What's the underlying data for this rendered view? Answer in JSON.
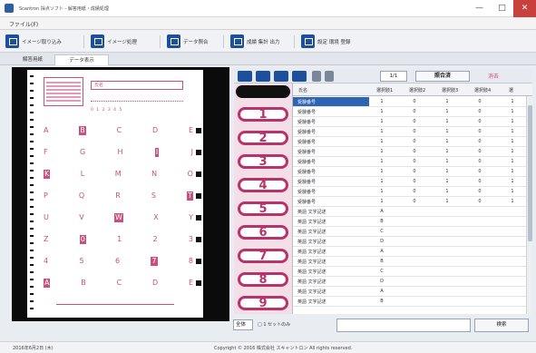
{
  "window": {
    "title": "Scantron 採点ソフト - 解答用紙・成績処理",
    "controls": {
      "minimize": "—",
      "maximize": "□",
      "close": "✕"
    }
  },
  "menubar": {
    "item": "ファイル(F)"
  },
  "toolbar": {
    "buttons": [
      {
        "label": "イメージ取り込み",
        "icon": "image-import-icon"
      },
      {
        "label": "イメージ処理",
        "icon": "image-process-icon"
      },
      {
        "label": "データ照合",
        "icon": "data-check-icon"
      },
      {
        "label": "成績 集計 出力",
        "icon": "report-output-icon"
      },
      {
        "label": "設定 環境 登録",
        "icon": "settings-folder-icon"
      }
    ]
  },
  "tabs": [
    {
      "label": "解答用紙",
      "active": false
    },
    {
      "label": "データ表示",
      "active": true
    }
  ],
  "answer_sheet": {
    "name_field": "氏名",
    "mini_row": "0 1 2 3 4 5",
    "bubble_rows": [
      {
        "cells": [
          "A",
          "B",
          "C",
          "D",
          "E"
        ],
        "filled": 1
      },
      {
        "cells": [
          "F",
          "G",
          "H",
          "I",
          "J"
        ],
        "filled": 3
      },
      {
        "cells": [
          "K",
          "L",
          "M",
          "N",
          "O"
        ],
        "filled": 0
      },
      {
        "cells": [
          "P",
          "Q",
          "R",
          "S",
          "T"
        ],
        "filled": 4
      },
      {
        "cells": [
          "U",
          "V",
          "W",
          "X",
          "Y"
        ],
        "filled": 2
      },
      {
        "cells": [
          "Z",
          "0",
          "1",
          "2",
          "3"
        ],
        "filled": 1
      },
      {
        "cells": [
          "4",
          "5",
          "6",
          "7",
          "8"
        ],
        "filled": 3
      },
      {
        "cells": [
          "A",
          "B",
          "C",
          "D",
          "E"
        ],
        "filled": 0
      }
    ]
  },
  "navigator": {
    "page": "1/1",
    "mode": "照合済",
    "right_label": "消去"
  },
  "question_numbers": [
    "1",
    "2",
    "3",
    "4",
    "5",
    "6",
    "7",
    "8",
    "9"
  ],
  "grid": {
    "headers": [
      "氏名",
      "選択肢1",
      "選択肢2",
      "選択肢3",
      "選択肢4",
      "選"
    ],
    "rows": [
      {
        "name": "受験番号",
        "values": [
          "1",
          "0",
          "1",
          "0",
          "1"
        ]
      },
      {
        "name": "受験番号",
        "values": [
          "1",
          "0",
          "1",
          "0",
          "1"
        ]
      },
      {
        "name": "受験番号",
        "values": [
          "1",
          "0",
          "1",
          "0",
          "1"
        ]
      },
      {
        "name": "受験番号",
        "values": [
          "1",
          "0",
          "1",
          "0",
          "1"
        ]
      },
      {
        "name": "受験番号",
        "values": [
          "1",
          "0",
          "1",
          "0",
          "1"
        ]
      },
      {
        "name": "受験番号",
        "values": [
          "1",
          "0",
          "1",
          "0",
          "1"
        ]
      },
      {
        "name": "受験番号",
        "values": [
          "1",
          "0",
          "1",
          "0",
          "1"
        ]
      },
      {
        "name": "受験番号",
        "values": [
          "1",
          "0",
          "1",
          "0",
          "1"
        ]
      },
      {
        "name": "受験番号",
        "values": [
          "1",
          "0",
          "1",
          "0",
          "1"
        ]
      },
      {
        "name": "受験番号",
        "values": [
          "1",
          "0",
          "1",
          "0",
          "1"
        ]
      },
      {
        "name": "受験番号",
        "values": [
          "1",
          "0",
          "1",
          "0",
          "1"
        ]
      },
      {
        "name": "英語  文字記述",
        "values": [
          "A",
          "",
          "",
          "",
          ""
        ]
      },
      {
        "name": "英語  文字記述",
        "values": [
          "B",
          "",
          "",
          "",
          ""
        ]
      },
      {
        "name": "英語  文字記述",
        "values": [
          "C",
          "",
          "",
          "",
          ""
        ]
      },
      {
        "name": "英語  文字記述",
        "values": [
          "D",
          "",
          "",
          "",
          ""
        ]
      },
      {
        "name": "英語  文字記述",
        "values": [
          "A",
          "",
          "",
          "",
          ""
        ]
      },
      {
        "name": "英語  文字記述",
        "values": [
          "B",
          "",
          "",
          "",
          ""
        ]
      },
      {
        "name": "英語  文字記述",
        "values": [
          "C",
          "",
          "",
          "",
          ""
        ]
      },
      {
        "name": "英語  文字記述",
        "values": [
          "D",
          "",
          "",
          "",
          ""
        ]
      },
      {
        "name": "英語  文字記述",
        "values": [
          "A",
          "",
          "",
          "",
          ""
        ]
      },
      {
        "name": "英語  文字記述",
        "values": [
          "B",
          "",
          "",
          "",
          ""
        ]
      }
    ]
  },
  "bottom_bar": {
    "select": "全体",
    "label": "□ 1 セットのみ",
    "button": "検索"
  },
  "statusbar": {
    "left": "2016年6月2日 (木)",
    "center": "Copyright © 2016 株式会社 スキャントロン All rights reserved."
  }
}
